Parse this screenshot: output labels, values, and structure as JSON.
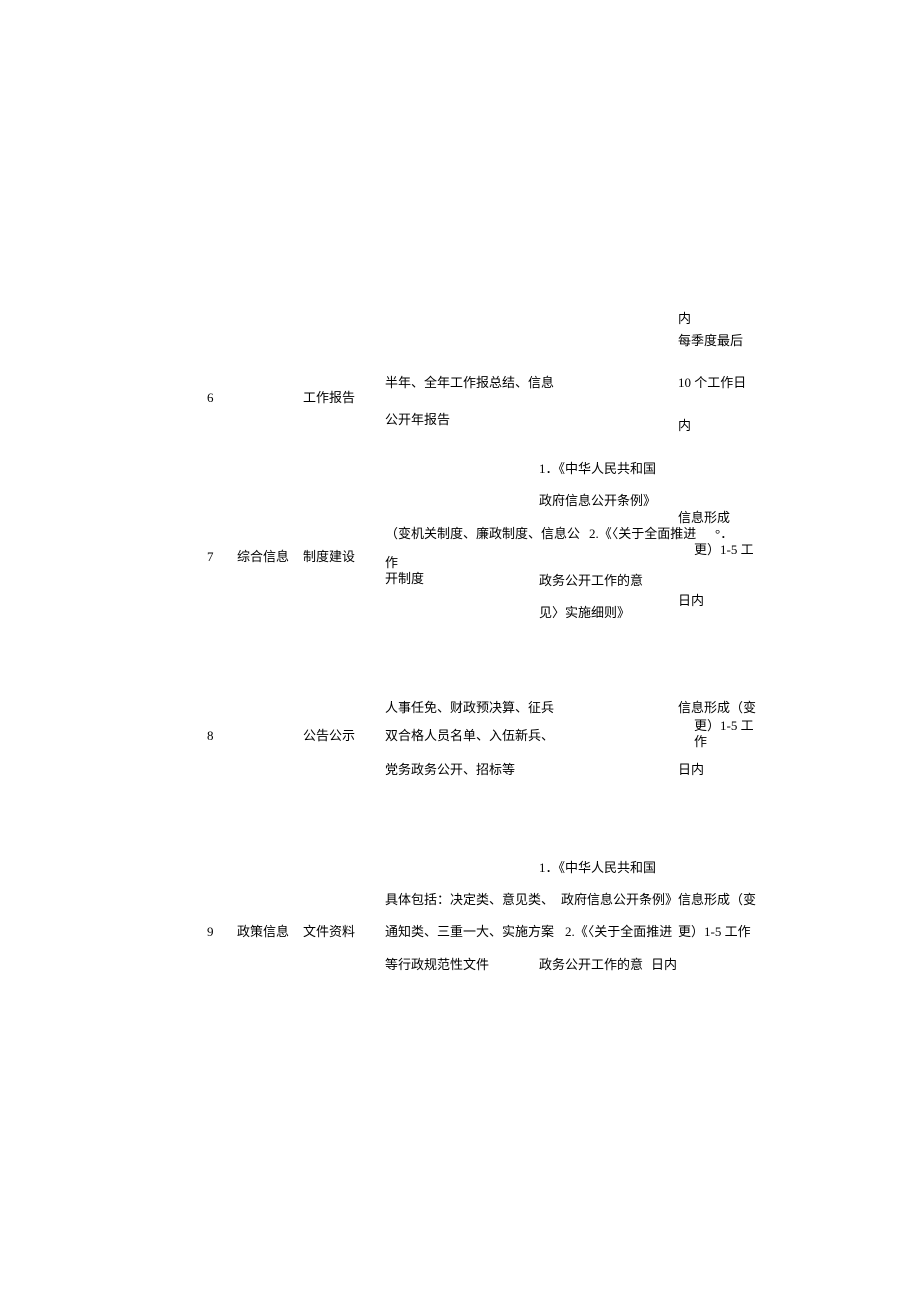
{
  "rows": [
    {
      "num": "6",
      "col1": "",
      "col2": "工作报告",
      "col3_line1": "半年、全年工作报总结、信息",
      "col3_line2": "公开年报告",
      "col4": "",
      "col5_line0": "内",
      "col5_line1": "每季度最后",
      "col5_line2": "10 个工作日",
      "col5_line3": "内"
    },
    {
      "num": "7",
      "col1": "综合信息",
      "col2": "制度建设",
      "col3_line1": "（变机关制度、廉政制度、信息公",
      "col3_line2": "开制度",
      "col4_line1": "1．《中华人民共和国",
      "col4_line2": "政府信息公开条例》",
      "col4_line3": "2.《〈关于全面推进",
      "col4_line4": "政务公开工作的意",
      "col4_line5": "见〉实施细则》",
      "col5_line1": "信息形成",
      "col5_line2": "更）1-5 工",
      "col5_line3": "日内",
      "col5_line2b": "作"
    },
    {
      "num": "8",
      "col1": "",
      "col2": "公告公示",
      "col3_line1": "人事任免、财政预决算、征兵",
      "col3_line2": "双合格人员名单、入伍新兵、",
      "col3_line3": "党务政务公开、招标等",
      "col4": "",
      "col5_line1": "信息形成（变",
      "col5_line2": "更）1-5 工",
      "col5_line2b": "作",
      "col5_line3": "日内"
    },
    {
      "num": "9",
      "col1": "政策信息",
      "col2": "文件资料",
      "col3_line1": "具体包括：决定类、意见类、",
      "col3_line2": "通知类、三重一大、实施方案",
      "col3_line3": "等行政规范性文件",
      "col4_line1": "1．《中华人民共和国",
      "col4_line2": "政府信息公开条例》",
      "col4_line3": "2.《〈关于全面推进",
      "col4_line4": "政务公开工作的意",
      "col5_line1": "信息形成（变",
      "col5_line2": "更）1-5 工作",
      "col5_line3": "日内"
    }
  ]
}
